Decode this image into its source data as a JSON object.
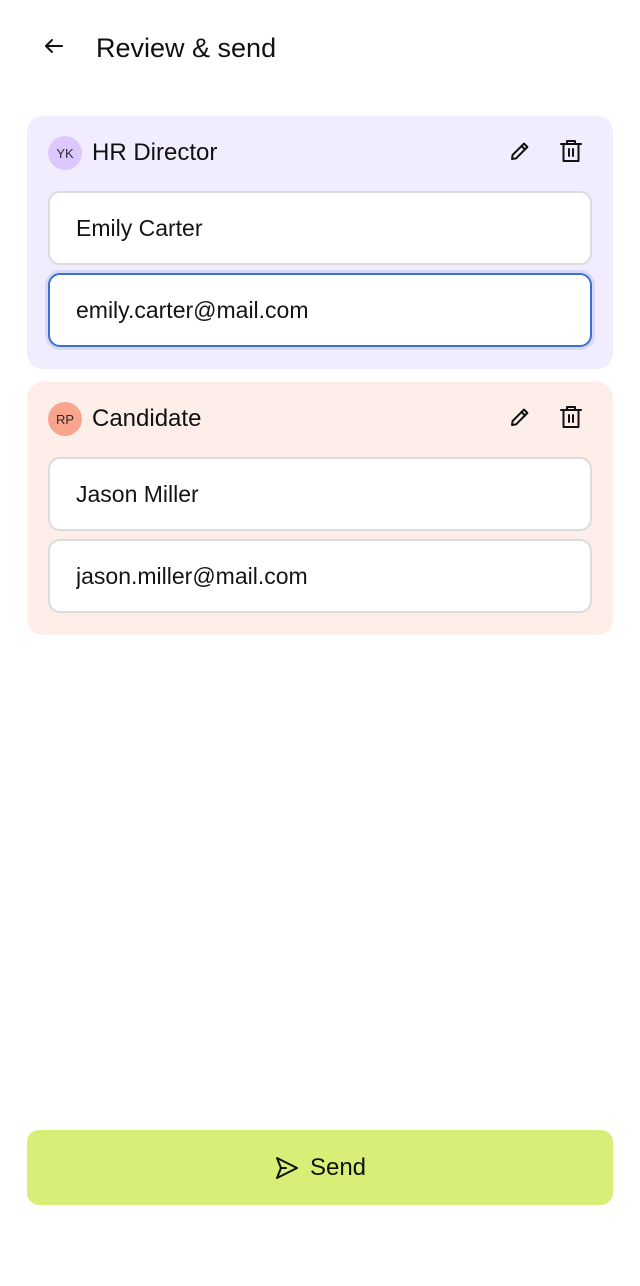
{
  "header": {
    "title": "Review & send",
    "back_icon": "arrow-left-icon"
  },
  "recipients": [
    {
      "initials": "YK",
      "role": "HR Director",
      "name": "Emily Carter",
      "email": "emily.carter@mail.com",
      "card_color": "#f2ecff",
      "avatar_color": "#dcc8ff",
      "focused_field": "email"
    },
    {
      "initials": "RP",
      "role": "Candidate",
      "name": "Jason Miller",
      "email": "jason.miller@mail.com",
      "card_color": "#fdeeea",
      "avatar_color": "#f9a58e"
    }
  ],
  "actions": {
    "edit_icon": "pencil-icon",
    "delete_icon": "trash-icon"
  },
  "send": {
    "label": "Send",
    "icon": "send-icon",
    "color": "#d8ef77"
  }
}
